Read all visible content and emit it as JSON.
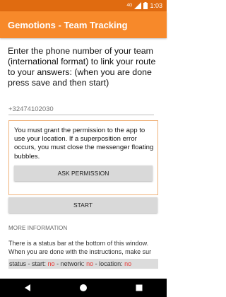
{
  "status_bar": {
    "network_badge": "4G",
    "time": "1:03"
  },
  "app_bar": {
    "title": "Gemotions - Team Tracking"
  },
  "instructions": "Enter the phone number of your team (international format) to link your route to your answers: (when you are done press save and then start)",
  "phone_input": {
    "placeholder": "+32474102030",
    "value": ""
  },
  "permission": {
    "message": "You must grant the permission to the app to use your location. If a superposition error occurs, you must close the messenger floating bubbles.",
    "button_label": "ASK PERMISSION"
  },
  "start_button": {
    "label": "START"
  },
  "more_info": {
    "title": "MORE INFORMATION",
    "line1": "There is a status bar at the bottom of this window.",
    "line2": "When you are done with the instructions, make sur"
  },
  "status_footer": {
    "start_label": "status - start:",
    "start_value": "no",
    "network_label": "- network:",
    "network_value": "no",
    "location_label": "- location:",
    "location_value": "no"
  },
  "icons": {
    "status": [
      "signal-icon",
      "battery-icon"
    ],
    "nav": [
      "back-icon",
      "home-icon",
      "recents-icon"
    ]
  },
  "colors": {
    "status_bar": "#e06b10",
    "app_bar": "#f7892a",
    "alert_red": "#e53935"
  }
}
